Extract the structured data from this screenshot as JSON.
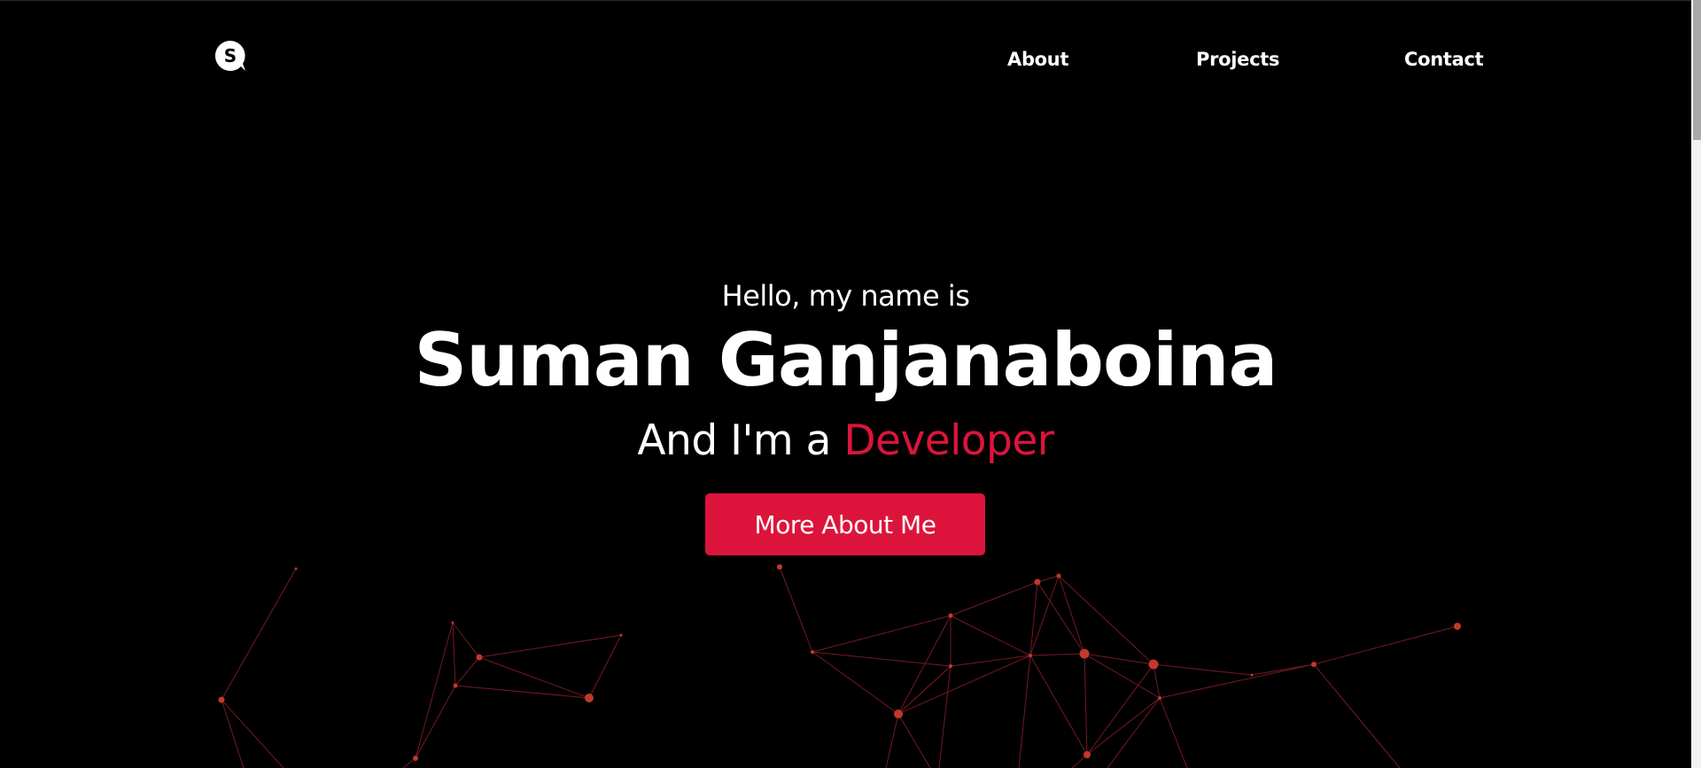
{
  "header": {
    "logo_icon": "s-chat-bubble-icon",
    "nav": [
      {
        "label": "About"
      },
      {
        "label": "Projects"
      },
      {
        "label": "Contact"
      }
    ]
  },
  "hero": {
    "greeting": "Hello, my name is",
    "name": "Suman Ganjanaboina",
    "role_prefix": "And I'm a ",
    "role_highlight": "Developer",
    "cta_label": "More About Me"
  },
  "colors": {
    "background": "#000000",
    "text": "#ffffff",
    "accent": "#dc143c",
    "network": "#c0392b"
  }
}
